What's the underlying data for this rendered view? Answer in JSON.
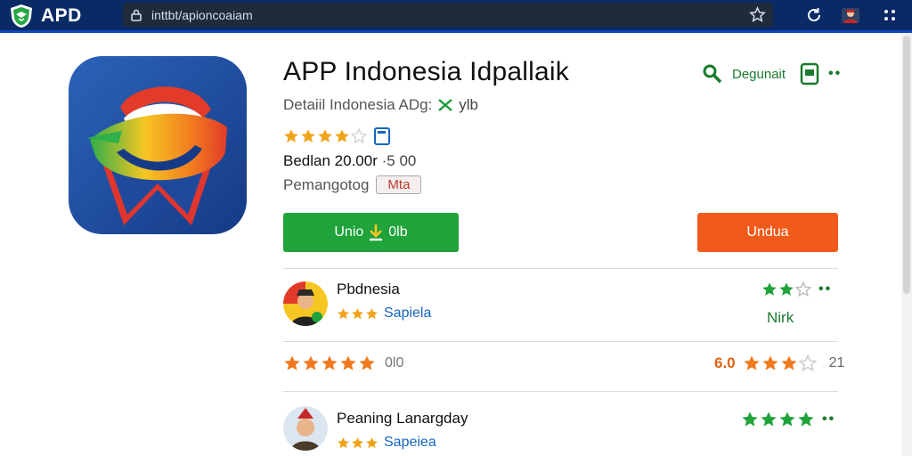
{
  "browser": {
    "brand": "APD",
    "url": "inttbt/apioncoaiam"
  },
  "app": {
    "title": "APP Indonesia Idpallaik",
    "subtitle": "Detaiil Indonesia ADg:",
    "subtitle_tag": "ylb",
    "rating": 4,
    "release_label": "Bedlan 20.00r",
    "release_value": "·5 00",
    "developer_label": "Pemangotog",
    "developer_badge": "Mta",
    "wishlist_label": "Degunait"
  },
  "buttons": {
    "install": "Unio",
    "install_suffix": "0lb",
    "uninstall": "Undua"
  },
  "list": [
    {
      "name": "Pbdnesia",
      "rating_small": 3,
      "sub_label": "Sapiela",
      "right_stars": 2,
      "right_total": 3,
      "right_text": "Nirk"
    },
    {
      "score_stars": 5,
      "score_label": "0l0",
      "score_value": "6.0",
      "score_right_stars": 3,
      "score_right_total": 4,
      "score_count": "21"
    },
    {
      "name": "Peaning Lanargday",
      "rating_small": 3,
      "sub_label": "Sapeiea",
      "right_stars": 4,
      "right_total": 4
    }
  ],
  "colors": {
    "green": "#1fa33a",
    "orange": "#f05a1a",
    "star": "#f0a31a",
    "navy": "#0a2a66"
  }
}
